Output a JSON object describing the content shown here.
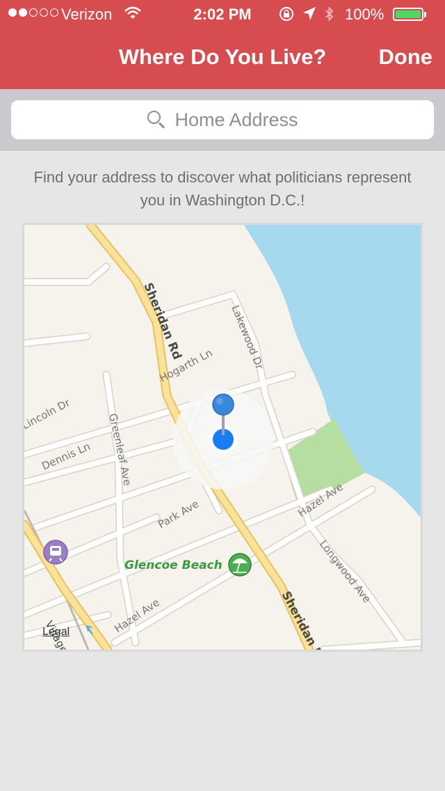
{
  "status_bar": {
    "carrier": "Verizon",
    "time": "2:02 PM",
    "battery_pct": "100%",
    "signal_bars_filled": 2,
    "signal_bars_total": 5
  },
  "nav": {
    "title": "Where Do You Live?",
    "done_label": "Done"
  },
  "search": {
    "placeholder": "Home Address"
  },
  "message": "Find your address to discover what politicians represent you in Washington D.C.!",
  "map": {
    "labels": {
      "sheridan_rd_north": "Sheridan Rd",
      "sheridan_rd_south": "Sheridan R",
      "lakewood_dr": "Lakewood Dr",
      "hogarth_ln": "Hogarth Ln",
      "lincoln_dr": "Lincoln Dr",
      "greenleaf_ave": "Greenleaf Ave",
      "dennis_ln": "Dennis Ln",
      "park_ave": "Park Ave",
      "hazel_ave_east": "Hazel Ave",
      "hazel_ave_west": "Hazel Ave",
      "longwood_ave": "Longwood Ave",
      "glencoe_beach": "Glencoe Beach",
      "village": "Village"
    },
    "legal": "Legal",
    "colors": {
      "land": "#f6f3ec",
      "water": "#a6d8ee",
      "park": "#b5dea0",
      "major_road": "#fbe29a",
      "minor_road": "#ffffff",
      "user_location": "#1a7cf5",
      "pin": "#3b88d9",
      "poi_label": "#3c9a40"
    },
    "icons": [
      "train-station-icon",
      "beach-umbrella-icon",
      "location-arrow-icon"
    ]
  }
}
